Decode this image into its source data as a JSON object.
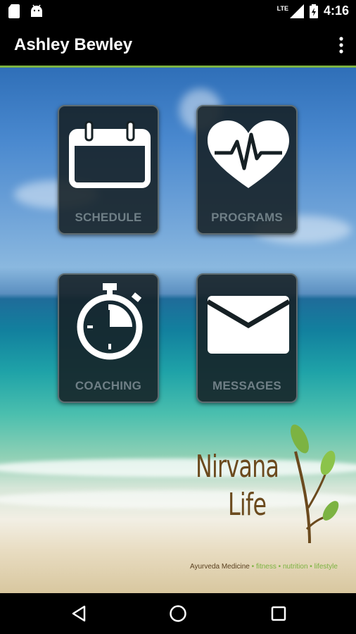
{
  "status_bar": {
    "time": "4:16",
    "network_label": "LTE",
    "left_icons": [
      "sd-card-icon",
      "android-icon"
    ],
    "right_icons": [
      "signal-icon",
      "battery-icon"
    ]
  },
  "app_bar": {
    "title": "Ashley Bewley",
    "menu_icon": "overflow-menu-icon",
    "accent_color": "#7cb342"
  },
  "tiles": [
    {
      "label": "SCHEDULE",
      "icon": "calendar-icon"
    },
    {
      "label": "PROGRAMS",
      "icon": "heart-pulse-icon"
    },
    {
      "label": "COACHING",
      "icon": "stopwatch-icon"
    },
    {
      "label": "MESSAGES",
      "icon": "envelope-icon"
    }
  ],
  "logo": {
    "word1": "Nirvana",
    "word2": "Life",
    "tagline": {
      "part1": "Ayurveda Medicine",
      "separator": "•",
      "part2": "fitness",
      "part3": "nutrition",
      "part4": "lifestyle"
    }
  },
  "nav_bar": {
    "icons": [
      "back-icon",
      "home-icon",
      "recents-icon"
    ]
  }
}
